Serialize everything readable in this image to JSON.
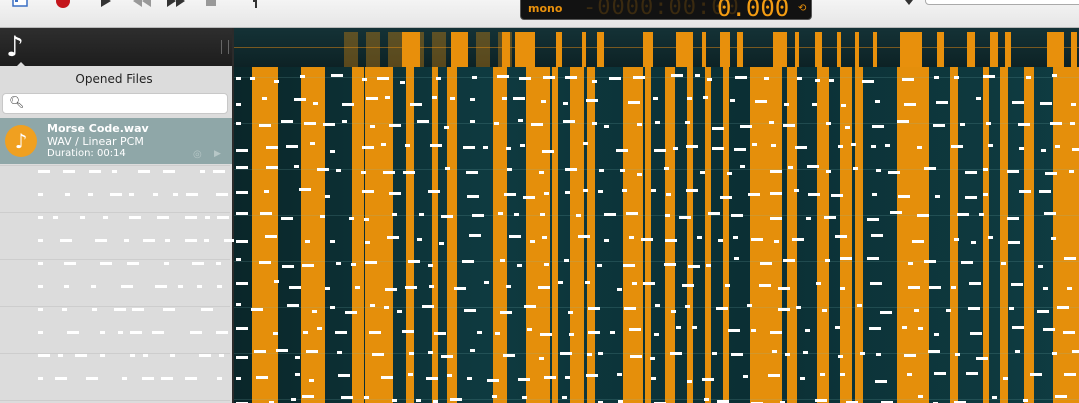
{
  "toolbar": {
    "buttons": [
      {
        "name": "window-icon"
      },
      {
        "name": "record-icon",
        "color": "#c4161c"
      },
      {
        "name": "play-icon"
      },
      {
        "name": "rewind-icon"
      },
      {
        "name": "fast-forward-icon"
      },
      {
        "name": "stop-icon"
      },
      {
        "name": "help-icon"
      }
    ],
    "lcd": {
      "channel": "mono",
      "ghost_digits": "-0000:00:00",
      "time": "0.000",
      "loop_icon": "loop-icon"
    },
    "accent": "#e8900c"
  },
  "sidebar": {
    "title": "Opened Files",
    "search_placeholder": "",
    "files": [
      {
        "name": "Morse Code.wav",
        "format": "WAV / Linear PCM",
        "duration": "Duration: 00:14"
      }
    ]
  },
  "colors": {
    "waveform_bg": "#0b2d33",
    "waveform_bar": "#e58f0b",
    "selection": "#8fa7a8"
  }
}
